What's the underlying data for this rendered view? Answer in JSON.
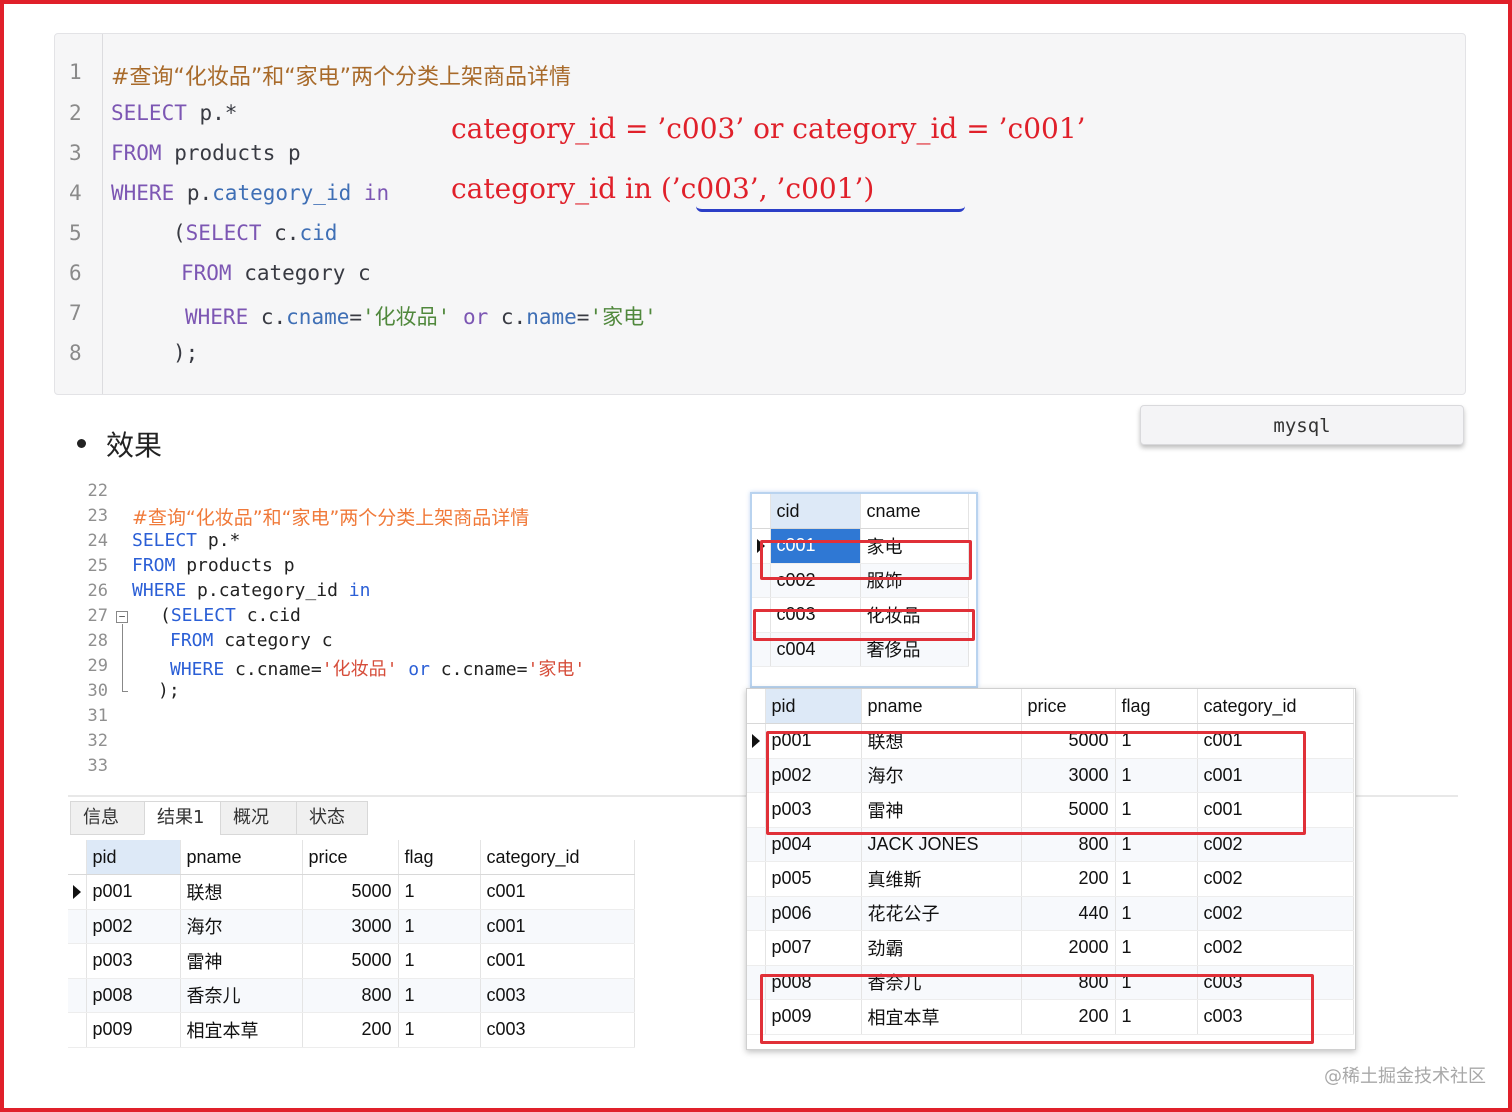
{
  "code_block": {
    "lines": [
      "#查询“化妆品”和“家电”两个分类上架商品详情",
      "SELECT p.*",
      "FROM products p",
      "WHERE p.category_id in",
      "    (SELECT c.cid",
      "     FROM category c",
      "     WHERE c.cname='化妆品' or c.name='家电'",
      "    );"
    ],
    "line_numbers": [
      "1",
      "2",
      "3",
      "4",
      "5",
      "6",
      "7",
      "8"
    ],
    "tokens": {
      "l2_kw": "SELECT",
      "l2_rest": " p.*",
      "l3_kw": "FROM",
      "l3_rest": " products p",
      "l4_kw": "WHERE",
      "l4_p": " p.",
      "l4_prop": "category_id",
      "l4_in": " in",
      "l5_open": "(",
      "l5_kw": "SELECT",
      "l5_c": " c.",
      "l5_prop": "cid",
      "l6_kw": "FROM",
      "l6_rest": " category c",
      "l7_kw": "WHERE",
      "l7_c": " c.",
      "l7_prop": "cname",
      "l7_eq": "=",
      "l7_str1": "'化妆品'",
      "l7_or": " or ",
      "l7_c2": "c.",
      "l7_prop2": "name",
      "l7_eq2": "=",
      "l7_str2": "'家电'",
      "l8": ");"
    },
    "annotations": [
      "category_id = ’c003’ or category_id = ’c001’",
      "category_id in (’c003’, ’c001’)"
    ]
  },
  "lang_button": "mysql",
  "bullet": "效果",
  "editor": {
    "line_numbers": [
      "22",
      "23",
      "24",
      "25",
      "26",
      "27",
      "28",
      "29",
      "30",
      "31",
      "32",
      "33"
    ],
    "comment": "#查询“化妆品”和“家电”两个分类上架商品详情",
    "l24_kw": "SELECT",
    "l24_rest": " p.*",
    "l25_kw": "FROM",
    "l25_rest": " products p",
    "l26_kw": "WHERE",
    "l26_rest": " p.category_id ",
    "l26_in": "in",
    "l27_open": "(",
    "l27_kw": "SELECT",
    "l27_rest": " c.cid",
    "l28_kw": "FROM",
    "l28_rest": " category c",
    "l29_kw": "WHERE",
    "l29_rest": " c.cname=",
    "l29_str1": "'化妆品'",
    "l29_or": " or ",
    "l29_rest2": "c.cname=",
    "l29_str2": "'家电'",
    "l30": ");"
  },
  "result_tabs": [
    "信息",
    "结果1",
    "概况",
    "状态"
  ],
  "category_table": {
    "columns": [
      "cid",
      "cname"
    ],
    "rows": [
      [
        "c001",
        "家电"
      ],
      [
        "c002",
        "服饰"
      ],
      [
        "c003",
        "化妆品"
      ],
      [
        "c004",
        "奢侈品"
      ]
    ]
  },
  "products_table": {
    "columns": [
      "pid",
      "pname",
      "price",
      "flag",
      "category_id"
    ],
    "rows": [
      [
        "p001",
        "联想",
        "5000",
        "1",
        "c001"
      ],
      [
        "p002",
        "海尔",
        "3000",
        "1",
        "c001"
      ],
      [
        "p003",
        "雷神",
        "5000",
        "1",
        "c001"
      ],
      [
        "p004",
        "JACK JONES",
        "800",
        "1",
        "c002"
      ],
      [
        "p005",
        "真维斯",
        "200",
        "1",
        "c002"
      ],
      [
        "p006",
        "花花公子",
        "440",
        "1",
        "c002"
      ],
      [
        "p007",
        "劲霸",
        "2000",
        "1",
        "c002"
      ],
      [
        "p008",
        "香奈儿",
        "800",
        "1",
        "c003"
      ],
      [
        "p009",
        "相宜本草",
        "200",
        "1",
        "c003"
      ]
    ]
  },
  "result_table": {
    "columns": [
      "pid",
      "pname",
      "price",
      "flag",
      "category_id"
    ],
    "rows": [
      [
        "p001",
        "联想",
        "5000",
        "1",
        "c001"
      ],
      [
        "p002",
        "海尔",
        "3000",
        "1",
        "c001"
      ],
      [
        "p003",
        "雷神",
        "5000",
        "1",
        "c001"
      ],
      [
        "p008",
        "香奈儿",
        "800",
        "1",
        "c003"
      ],
      [
        "p009",
        "相宜本草",
        "200",
        "1",
        "c003"
      ]
    ]
  },
  "watermark": "@稀土掘金技术社区",
  "colors": {
    "annotation_red": "#e0202a",
    "underline_blue": "#2b3ec7",
    "selected_cell": "#2f78d4"
  }
}
